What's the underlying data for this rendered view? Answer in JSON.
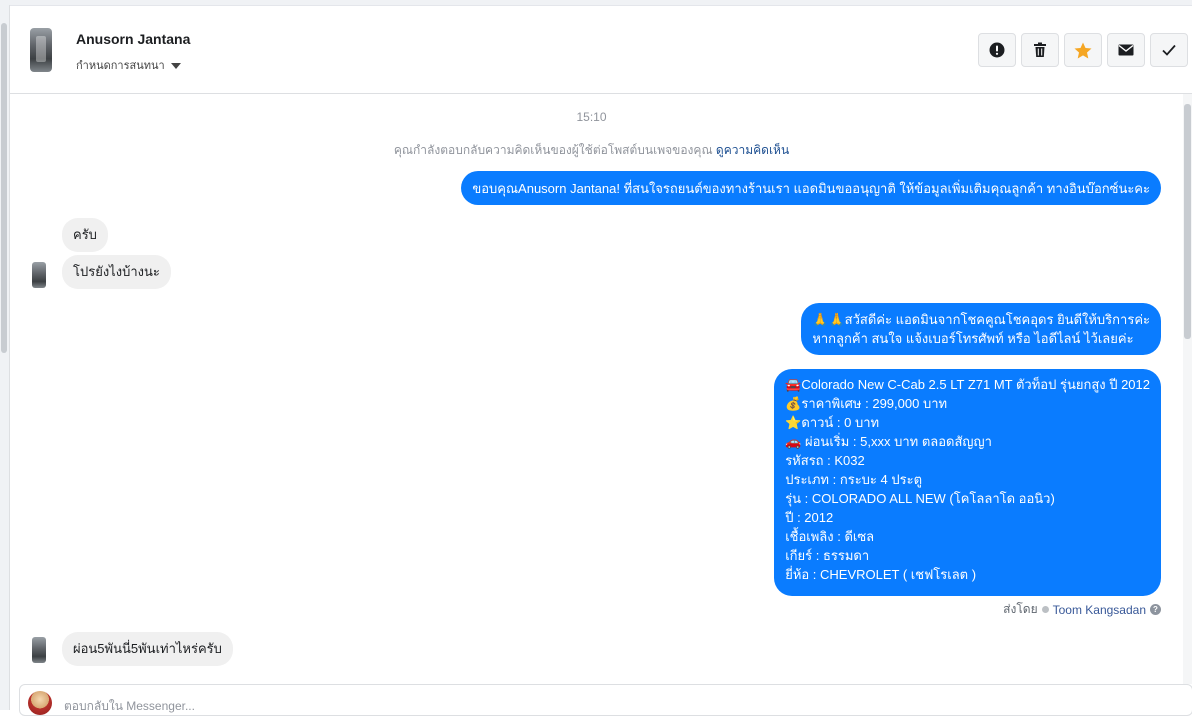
{
  "header": {
    "contact_name": "Anusorn Jantana",
    "assign_label": "กำหนดการสนทนา",
    "actions": [
      {
        "name": "spam-icon"
      },
      {
        "name": "trash-icon"
      },
      {
        "name": "star-icon"
      },
      {
        "name": "mail-icon"
      },
      {
        "name": "check-icon"
      }
    ]
  },
  "conversation": {
    "timestamp": "15:10",
    "notice_text": "คุณกำลังตอบกลับความคิดเห็นของผู้ใช้ต่อโพสต์บนเพจของคุณ",
    "notice_link": "ดูความคิดเห็น",
    "messages": [
      {
        "side": "out",
        "lines": [
          "ขอบคุณAnusorn Jantana! ที่สนใจรถยนต์ของทางร้านเรา แอดมินขออนุญาติ ให้ข้อมูลเพิ่มเติมคุณลูกค้า ทางอินบ๊อกซ์นะคะ"
        ]
      },
      {
        "side": "in",
        "lines": [
          "ครับ"
        ]
      },
      {
        "side": "in",
        "lines": [
          "โปรยังไงบ้างนะ"
        ]
      },
      {
        "side": "out",
        "lines": [
          "🙏🙏สวัสดีค่ะ แอดมินจากโชคคูณโชคอุดร ยินดีให้บริการค่ะ",
          "หากลูกค้า สนใจ แจ้งเบอร์โทรศัพท์ หรือ ไอดีไลน์  ไว้เลยค่ะ"
        ]
      },
      {
        "side": "out",
        "lines": [
          "🚘Colorado New C-Cab 2.5 LT Z71 MT ตัวท็อป รุ่นยกสูง ปี 2012",
          "💰ราคาพิเศษ : 299,000 บาท",
          "⭐ดาวน์ : 0 บาท",
          "🚗 ผ่อนเริ่ม : 5,xxx บาท ตลอดสัญญา",
          "รหัสรถ : K032",
          "ประเภท : กระบะ 4 ประตู",
          "รุ่น : COLORADO ALL NEW (โคโลลาโด ออนิว)",
          "ปี : 2012",
          "เชื้อเพลิง : ดีเซล",
          "เกียร์ : ธรรมดา",
          "ยี่ห้อ : CHEVROLET ( เชฟโรเลต )"
        ]
      },
      {
        "side": "in",
        "lines": [
          "ผ่อน5พันนี่5พันเท่าไหร่ครับ"
        ]
      }
    ],
    "sent_by_label": "ส่งโดย",
    "sent_by_name": "Toom Kangsadan",
    "help_glyph": "?"
  },
  "composer": {
    "placeholder": "ตอบกลับใน Messenger..."
  },
  "colors": {
    "outgoing_bubble": "#0a7cff",
    "incoming_bubble": "#f0f0f0",
    "star": "#f5a623"
  }
}
